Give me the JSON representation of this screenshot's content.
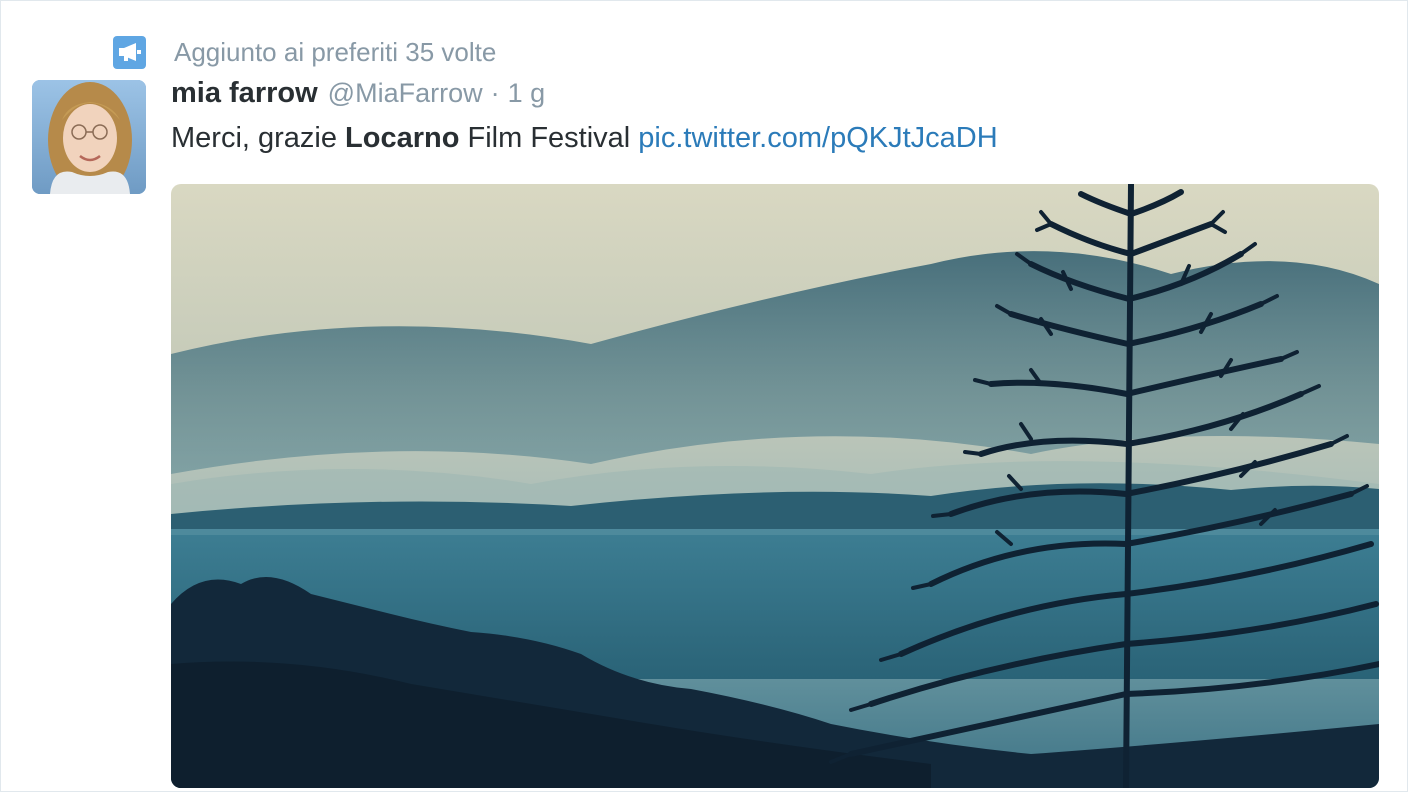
{
  "context": {
    "icon": "megaphone-icon",
    "text": "Aggiunto ai preferiti 35 volte"
  },
  "tweet": {
    "author_name": "mia farrow",
    "author_handle": "@MiaFarrow",
    "separator": "·",
    "timestamp": "1 g",
    "text_parts": {
      "before": "Merci, grazie ",
      "highlight": "Locarno",
      "after": " Film Festival ",
      "link": "pic.twitter.com/pQKJtJcaDH"
    }
  },
  "colors": {
    "accent": "#5fa6e3",
    "link": "#2b7bb9",
    "muted": "#8899a6",
    "text": "#292f33"
  }
}
